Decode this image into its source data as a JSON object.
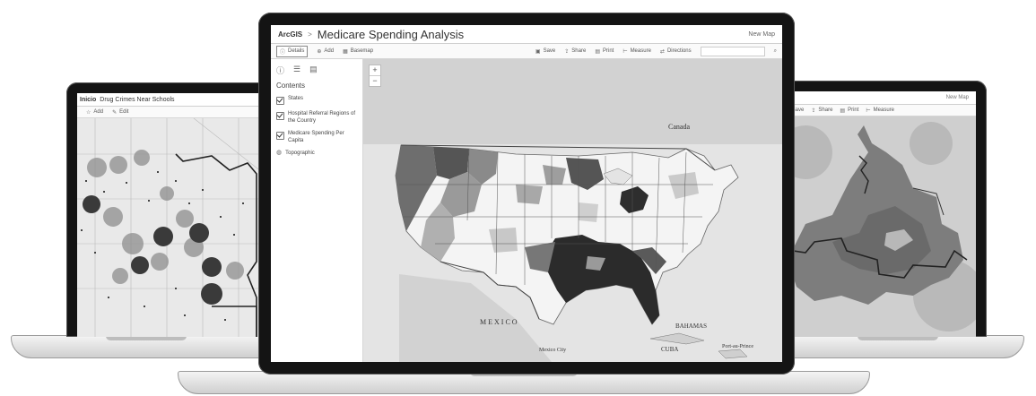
{
  "left_screen": {
    "brand": "Inicio",
    "title": "Drug Crimes Near Schools",
    "toolbar": [
      {
        "icon": "star-icon",
        "label": "Add"
      },
      {
        "icon": "pencil-icon",
        "label": "Edit"
      }
    ]
  },
  "center_screen": {
    "brand": "ArcGIS",
    "brand_chevron": ">",
    "title": "Medicare Spending Analysis",
    "user": "New Map",
    "toolbar_left": [
      {
        "icon": "info-icon",
        "label": "Details"
      },
      {
        "icon": "add-icon",
        "label": "Add"
      },
      {
        "icon": "basemap-icon",
        "label": "Basemap"
      }
    ],
    "toolbar_right": [
      {
        "icon": "save-icon",
        "label": "Save"
      },
      {
        "icon": "share-icon",
        "label": "Share"
      },
      {
        "icon": "print-icon",
        "label": "Print"
      },
      {
        "icon": "measure-icon",
        "label": "Measure"
      },
      {
        "icon": "directions-icon",
        "label": "Directions"
      }
    ],
    "panel": {
      "heading": "Contents",
      "layers": [
        {
          "label": "States",
          "checked": true
        },
        {
          "label": "Hospital Referral Regions of the Country",
          "checked": true
        },
        {
          "label": "Medicare Spending Per Capita",
          "checked": true
        },
        {
          "label": "Topographic",
          "checked": false
        }
      ]
    },
    "map_labels": {
      "canada": "Canada",
      "mexico": "MEXICO",
      "cuba": "CUBA",
      "bahamas": "BAHAMAS",
      "mexico_city": "Mexico City",
      "port_au_prince": "Port-au-Prince"
    }
  },
  "right_screen": {
    "toolbar": [
      {
        "icon": "save-icon",
        "label": "Save"
      },
      {
        "icon": "share-icon",
        "label": "Share"
      },
      {
        "icon": "print-icon",
        "label": "Print"
      },
      {
        "icon": "measure-icon",
        "label": "Measure"
      }
    ],
    "user": "New Map"
  },
  "colors": {
    "bezel": "#141414",
    "dark_region": "#2b2b2b",
    "mid_region": "#7a7a7a",
    "light_region": "#bdbdbd"
  }
}
